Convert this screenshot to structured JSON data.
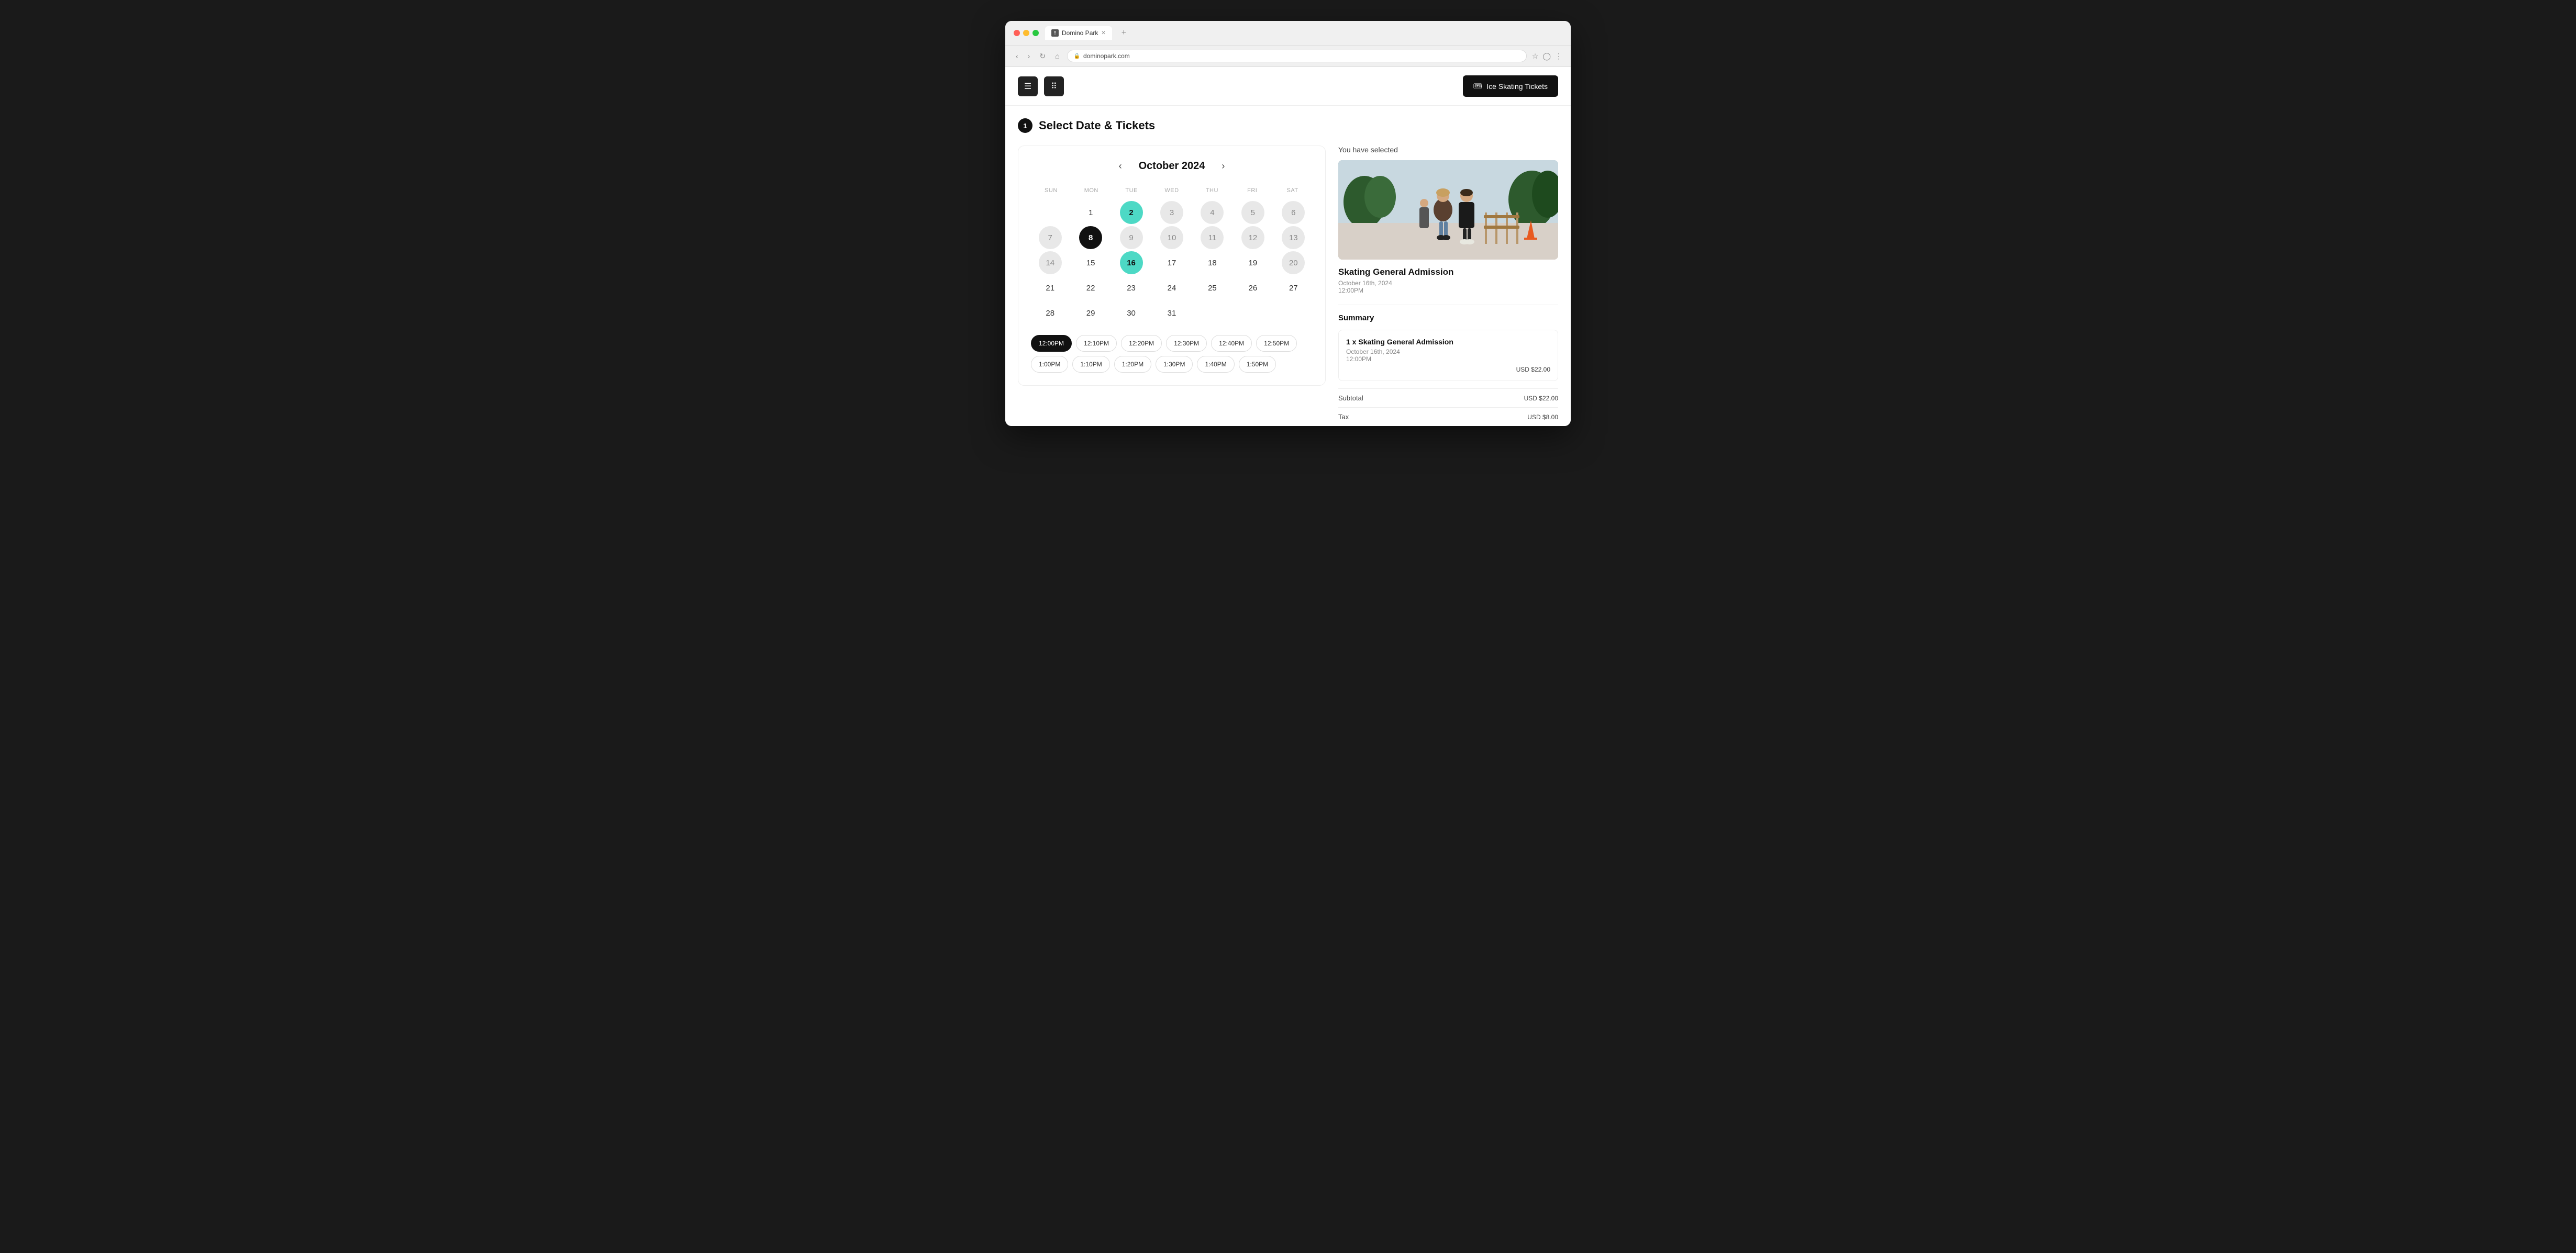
{
  "browser": {
    "tab_title": "Domino Park",
    "url": "dominopark.com",
    "new_tab_label": "+"
  },
  "header": {
    "hamburger_label": "☰",
    "dots_label": "⠿",
    "cta_button_label": "Ice Skating Tickets",
    "cta_icon": "🎟"
  },
  "page": {
    "step_number": "1",
    "section_title": "Select Date & Tickets"
  },
  "calendar": {
    "month_title": "October 2024",
    "weekdays": [
      "SUN",
      "MON",
      "TUE",
      "WED",
      "THU",
      "FRI",
      "SAT"
    ],
    "nav_prev": "‹",
    "nav_next": "›",
    "days": [
      {
        "label": "",
        "state": "empty"
      },
      {
        "label": "1",
        "state": "normal"
      },
      {
        "label": "2",
        "state": "selected-teal"
      },
      {
        "label": "3",
        "state": "available"
      },
      {
        "label": "4",
        "state": "available"
      },
      {
        "label": "5",
        "state": "available"
      },
      {
        "label": "6",
        "state": "available"
      },
      {
        "label": "7",
        "state": "available"
      },
      {
        "label": "8",
        "state": "selected-black"
      },
      {
        "label": "9",
        "state": "available"
      },
      {
        "label": "10",
        "state": "available"
      },
      {
        "label": "11",
        "state": "available"
      },
      {
        "label": "12",
        "state": "available"
      },
      {
        "label": "13",
        "state": "available"
      },
      {
        "label": "14",
        "state": "available"
      },
      {
        "label": "15",
        "state": "normal"
      },
      {
        "label": "16",
        "state": "selected-teal"
      },
      {
        "label": "17",
        "state": "normal"
      },
      {
        "label": "18",
        "state": "normal"
      },
      {
        "label": "19",
        "state": "normal"
      },
      {
        "label": "20",
        "state": "available"
      },
      {
        "label": "21",
        "state": "normal"
      },
      {
        "label": "22",
        "state": "normal"
      },
      {
        "label": "23",
        "state": "normal"
      },
      {
        "label": "24",
        "state": "normal"
      },
      {
        "label": "25",
        "state": "normal"
      },
      {
        "label": "26",
        "state": "normal"
      },
      {
        "label": "27",
        "state": "normal"
      },
      {
        "label": "28",
        "state": "normal"
      },
      {
        "label": "29",
        "state": "normal"
      },
      {
        "label": "30",
        "state": "normal"
      },
      {
        "label": "31",
        "state": "normal"
      }
    ]
  },
  "time_slots": {
    "row1": [
      "12:00PM",
      "12:10PM",
      "12:20PM",
      "12:30PM",
      "12:40PM",
      "12:50PM"
    ],
    "row2": [
      "1:00PM",
      "1:10PM",
      "1:20PM",
      "1:30PM",
      "1:40PM",
      "1:50PM"
    ],
    "selected": "12:00PM"
  },
  "right_panel": {
    "you_have_selected": "You have selected",
    "event_name": "Skating General Admission",
    "event_date": "October 16th, 2024",
    "event_time": "12:00PM",
    "summary_label": "Summary",
    "summary_item_title": "1 x Skating General Admission",
    "summary_item_date": "October 16th, 2024",
    "summary_item_time": "12:00PM",
    "summary_item_price": "USD $22.00",
    "subtotal_label": "Subtotal",
    "subtotal_value": "USD $22.00",
    "tax_label": "Tax",
    "tax_value": "USD $8.00"
  }
}
